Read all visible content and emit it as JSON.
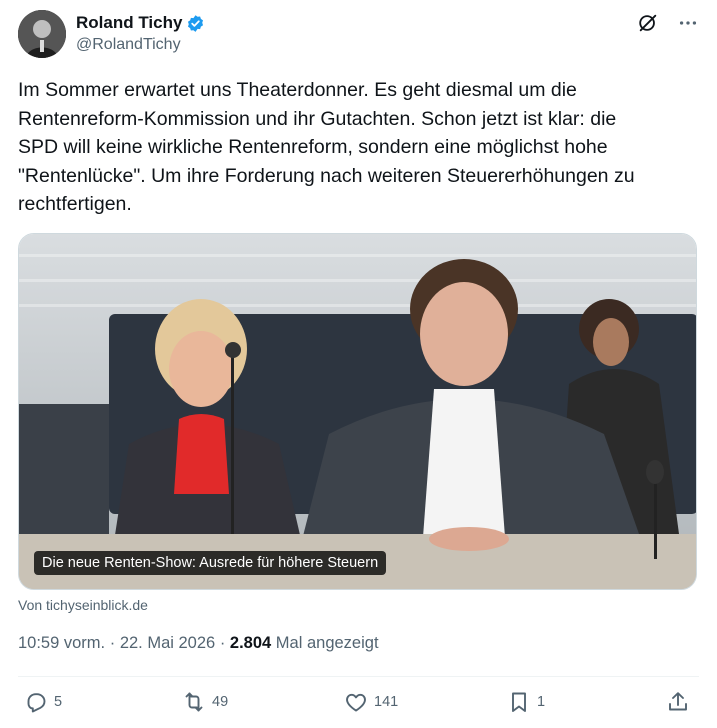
{
  "author": {
    "display_name": "Roland Tichy",
    "handle": "@RolandTichy",
    "verified": true
  },
  "icons": {
    "avatar": "avatar",
    "verified": "verified-badge-icon",
    "grok": "grok-icon",
    "more": "more-icon",
    "reply": "reply-icon",
    "repost": "repost-icon",
    "like": "like-icon",
    "bookmark": "bookmark-icon",
    "share": "share-icon"
  },
  "tweet": {
    "text": "Im Sommer erwartet uns Theaterdonner. Es geht diesmal um die\nRentenreform-Kommission und ihr Gutachten. Schon jetzt ist klar: die\nSPD will keine wirkliche Rentenreform, sondern eine möglichst hohe\n\"Rentenlücke\". Um ihre Forderung nach weiteren Steuererhöhungen zu\nrechtfertigen."
  },
  "card": {
    "caption": "Die neue Renten-Show: Ausrede für höhere Steuern",
    "source": "Von tichyseinblick.de"
  },
  "meta": {
    "time": "10:59 vorm.",
    "separator": "·",
    "date": "22. Mai 2026",
    "views_count": "2.804",
    "views_label": "Mal angezeigt"
  },
  "actions": {
    "replies": "5",
    "reposts": "49",
    "likes": "141",
    "bookmarks": "1"
  },
  "colors": {
    "text": "#0f1419",
    "secondary": "#536471",
    "verified": "#1d9bf0"
  }
}
